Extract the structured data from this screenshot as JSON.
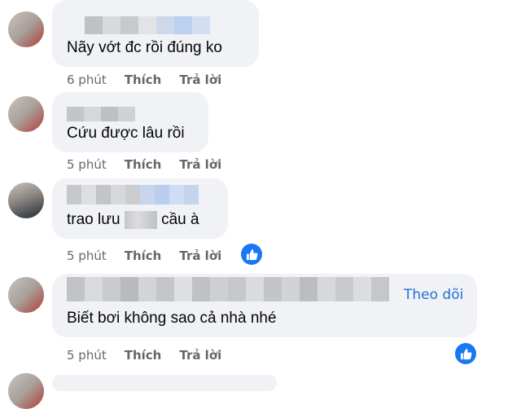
{
  "comments": [
    {
      "text": "Nãy vớt đc rồi đúng ko",
      "time": "6 phút",
      "like": "Thích",
      "reply": "Trả lời"
    },
    {
      "text": "Cứu được lâu rồi",
      "time": "5 phút",
      "like": "Thích",
      "reply": "Trả lời"
    },
    {
      "text_before": "trao lưu",
      "text_after": "cầu à",
      "time": "5 phút",
      "like": "Thích",
      "reply": "Trả lời",
      "reactions": [
        "like-icon"
      ]
    },
    {
      "text": "Biết bơi không sao cả nhà nhé",
      "follow": "Theo dõi",
      "time": "5 phút",
      "like": "Thích",
      "reply": "Trả lời",
      "reactions": [
        "like-icon"
      ]
    }
  ],
  "colors": {
    "bubble": "#f0f2f5",
    "meta": "#65676b",
    "accent": "#1877f2",
    "follow": "#216fdb"
  }
}
